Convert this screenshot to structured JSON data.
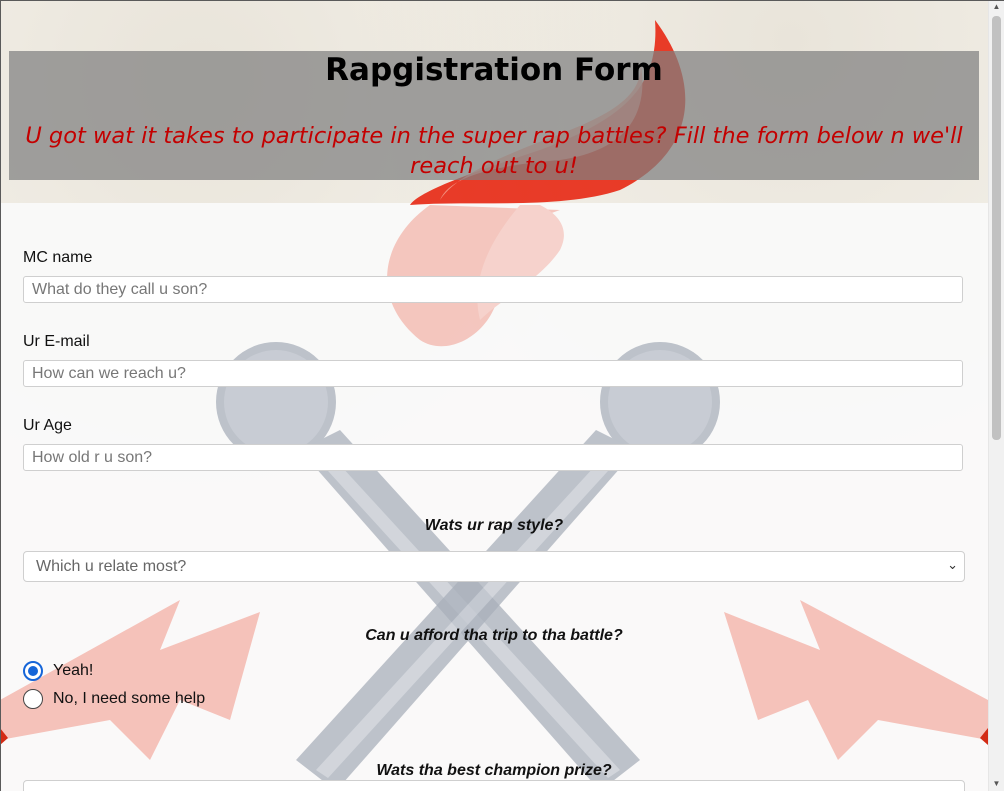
{
  "header": {
    "title": "Rapgistration Form",
    "subtitle": "U got wat it takes to participate in the super rap battles? Fill the form below n we'll reach out to u!"
  },
  "form": {
    "name": {
      "label": "MC name",
      "placeholder": "What do they call u son?",
      "value": ""
    },
    "email": {
      "label": "Ur E-mail",
      "placeholder": "How can we reach u?",
      "value": ""
    },
    "age": {
      "label": "Ur Age",
      "placeholder": "How old r u son?",
      "value": ""
    },
    "style": {
      "question": "Wats ur rap style?",
      "selected": "Which u relate most?"
    },
    "trip": {
      "question": "Can u afford tha trip to tha battle?",
      "options": [
        {
          "label": "Yeah!",
          "checked": true
        },
        {
          "label": "No, I need some help",
          "checked": false
        }
      ]
    },
    "prize": {
      "question": "Wats tha best champion prize?"
    }
  },
  "colors": {
    "accent": "#1565d8",
    "subtitle": "#c40000",
    "header_overlay": "#808080",
    "flame": "#e8321e",
    "microphone": "#a9b0bb"
  },
  "icons": {
    "select_arrow": "chevron-down-icon",
    "scroll_up": "scroll-up-arrow-icon",
    "scroll_down": "scroll-down-arrow-icon"
  }
}
